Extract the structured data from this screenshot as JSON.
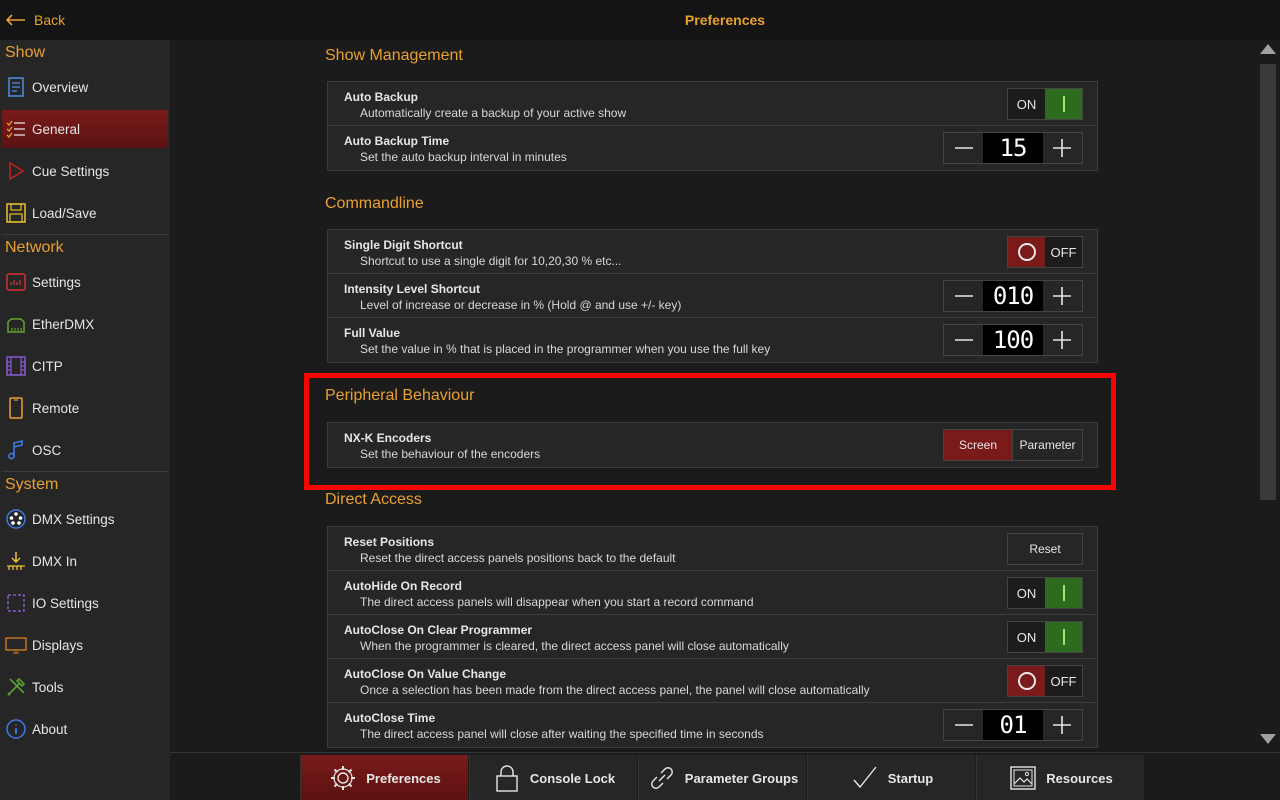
{
  "header": {
    "back_label": "Back",
    "title": "Preferences"
  },
  "sidebar": {
    "sections": [
      {
        "title": "Show",
        "items": [
          {
            "label": "Overview",
            "icon": "document-icon"
          },
          {
            "label": "General",
            "icon": "checklist-icon",
            "active": true
          },
          {
            "label": "Cue Settings",
            "icon": "play-icon"
          },
          {
            "label": "Load/Save",
            "icon": "floppy-icon"
          }
        ]
      },
      {
        "title": "Network",
        "items": [
          {
            "label": "Settings",
            "icon": "network-settings-icon"
          },
          {
            "label": "EtherDMX",
            "icon": "ethernet-icon"
          },
          {
            "label": "CITP",
            "icon": "film-icon"
          },
          {
            "label": "Remote",
            "icon": "phone-icon"
          },
          {
            "label": "OSC",
            "icon": "music-note-icon"
          }
        ]
      },
      {
        "title": "System",
        "items": [
          {
            "label": "DMX Settings",
            "icon": "dmx-connector-icon"
          },
          {
            "label": "DMX In",
            "icon": "dmx-in-icon"
          },
          {
            "label": "IO Settings",
            "icon": "io-icon"
          },
          {
            "label": "Displays",
            "icon": "monitor-icon"
          },
          {
            "label": "Tools",
            "icon": "tools-icon"
          },
          {
            "label": "About",
            "icon": "info-icon"
          }
        ]
      }
    ]
  },
  "main": {
    "show_management": {
      "title": "Show Management",
      "auto_backup": {
        "label": "Auto Backup",
        "desc": "Automatically create a backup of your active show",
        "state": "ON"
      },
      "auto_backup_time": {
        "label": "Auto Backup Time",
        "desc": "Set the auto backup interval in minutes",
        "value": "15"
      }
    },
    "commandline": {
      "title": "Commandline",
      "single_digit": {
        "label": "Single Digit Shortcut",
        "desc": "Shortcut to use a single digit for 10,20,30 % etc...",
        "state": "OFF"
      },
      "intensity": {
        "label": "Intensity Level Shortcut",
        "desc": "Level of increase or decrease in % (Hold @ and use +/- key)",
        "value": "010"
      },
      "full_value": {
        "label": "Full Value",
        "desc": "Set the value in % that is placed in the programmer when you use the full key",
        "value": "100"
      }
    },
    "peripheral": {
      "title": "Peripheral Behaviour",
      "encoders": {
        "label": "NX-K Encoders",
        "desc": "Set the behaviour of the encoders",
        "option_selected": "Screen",
        "option_other": "Parameter"
      }
    },
    "direct_access": {
      "title": "Direct Access",
      "reset_positions": {
        "label": "Reset Positions",
        "desc": "Reset the direct access panels positions back to the default",
        "button": "Reset"
      },
      "autohide": {
        "label": "AutoHide On Record",
        "desc": "The direct access panels will disappear when you start a record command",
        "state": "ON"
      },
      "autoclose_clear": {
        "label": "AutoClose On Clear Programmer",
        "desc": "When the programmer is cleared, the direct access panel will close automatically",
        "state": "ON"
      },
      "autoclose_value": {
        "label": "AutoClose On Value Change",
        "desc": "Once a selection has been made from the direct access panel, the panel will close automatically",
        "state": "OFF"
      },
      "autoclose_time": {
        "label": "AutoClose Time",
        "desc": "The direct access panel will close after waiting the specified time in seconds",
        "value": "01"
      }
    }
  },
  "bottom_tabs": [
    {
      "label": "Preferences",
      "icon": "gear-icon",
      "active": true
    },
    {
      "label": "Console Lock",
      "icon": "lock-icon"
    },
    {
      "label": "Parameter Groups",
      "icon": "link-icon"
    },
    {
      "label": "Startup",
      "icon": "checkmark-icon"
    },
    {
      "label": "Resources",
      "icon": "image-icon"
    }
  ],
  "colors": {
    "accent": "#e8a030",
    "active_red": "#7a1a1a",
    "on_green": "#2d6b1e",
    "highlight": "#ff0000"
  }
}
